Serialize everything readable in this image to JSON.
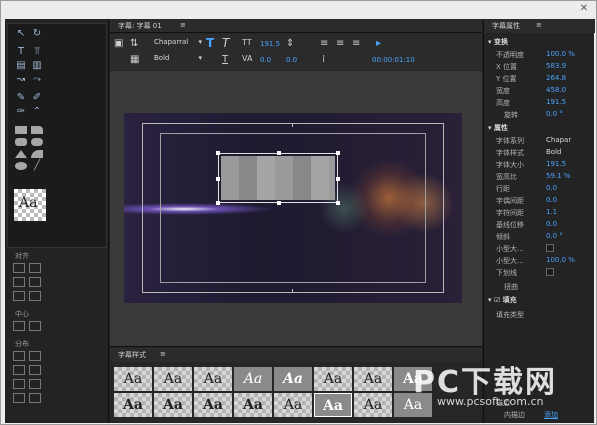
{
  "window": {
    "close_label": "✕"
  },
  "left": {
    "align_label": "对齐",
    "center_label": "中心",
    "distribute_label": "分布",
    "preview_text": "Aa"
  },
  "center": {
    "tab_title": "字幕: 字幕 01",
    "menu_icon": "≡",
    "font_family": "Chaparral",
    "font_style": "Bold",
    "font_size": "191.5",
    "kerning": "0.0",
    "leading": "0.0",
    "timecode": "00:00:01:10",
    "styles_title": "字幕样式",
    "style_samples": [
      "Aa",
      "Aa",
      "Aa",
      "Aa",
      "Aa",
      "Aa",
      "Aa",
      "Aa",
      "Aa",
      "Aa",
      "Aa",
      "Aa",
      "Aa",
      "Aa",
      "Aa",
      "Aa"
    ]
  },
  "right": {
    "tab_title": "字幕属性",
    "transform_title": "变换",
    "transform": [
      {
        "k": "不透明度",
        "v": "100.0 %"
      },
      {
        "k": "X 位置",
        "v": "583.9"
      },
      {
        "k": "Y 位置",
        "v": "264.8"
      },
      {
        "k": "宽度",
        "v": "458.0"
      },
      {
        "k": "高度",
        "v": "191.5"
      },
      {
        "k": "旋转",
        "v": "0.0 °"
      }
    ],
    "props_title": "属性",
    "props": [
      {
        "k": "字体系列",
        "v": "Chapar"
      },
      {
        "k": "字体样式",
        "v": "Bold"
      },
      {
        "k": "字体大小",
        "v": "191.5"
      },
      {
        "k": "宽高比",
        "v": "59.1 %"
      },
      {
        "k": "行距",
        "v": "0.0"
      },
      {
        "k": "字偶间距",
        "v": "0.0"
      },
      {
        "k": "字符间距",
        "v": "1.1"
      },
      {
        "k": "基线位移",
        "v": "0.0"
      },
      {
        "k": "倾斜",
        "v": "0.0 °"
      },
      {
        "k": "小型大...",
        "v": ""
      },
      {
        "k": "小型大...",
        "v": "100.0 %"
      },
      {
        "k": "下划线",
        "v": ""
      }
    ],
    "distort_label": "扭曲",
    "fill_title": "填充",
    "fill_type_label": "填充类型",
    "stroke_label": "描边",
    "inner_stroke_label": "内描边",
    "add_label": "添加"
  },
  "watermark": {
    "big": "PC下载网",
    "url": "www.pcsoft.com.cn"
  }
}
